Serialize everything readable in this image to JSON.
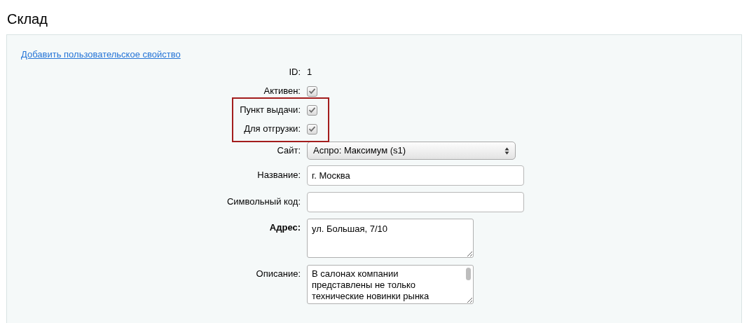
{
  "page_title": "Склад",
  "add_property_link": "Добавить пользовательское свойство",
  "fields": [
    {
      "kind": "text",
      "label": "ID:",
      "value": "1",
      "bold": false,
      "highlighted": false
    },
    {
      "kind": "checkbox",
      "label": "Активен:",
      "checked": true,
      "bold": false,
      "highlighted": false
    },
    {
      "kind": "checkbox",
      "label": "Пункт выдачи:",
      "checked": true,
      "bold": false,
      "highlighted": true
    },
    {
      "kind": "checkbox",
      "label": "Для отгрузки:",
      "checked": true,
      "bold": false,
      "highlighted": true
    },
    {
      "kind": "select",
      "label": "Сайт:",
      "value": "Аспро: Максимум (s1)",
      "bold": false,
      "highlighted": false
    },
    {
      "kind": "input",
      "label": "Название:",
      "value": "г. Москва",
      "bold": false,
      "highlighted": false
    },
    {
      "kind": "input",
      "label": "Символьный код:",
      "bold": false,
      "highlighted": false
    },
    {
      "kind": "textarea",
      "label": "Адрес:",
      "value": "ул. Большая, 7/10",
      "bold": true,
      "highlighted": false
    },
    {
      "kind": "textarea_scroll",
      "label": "Описание:",
      "value": "В салонах компании представлены не только технические новинки рынка",
      "bold": false,
      "highlighted": false
    }
  ]
}
